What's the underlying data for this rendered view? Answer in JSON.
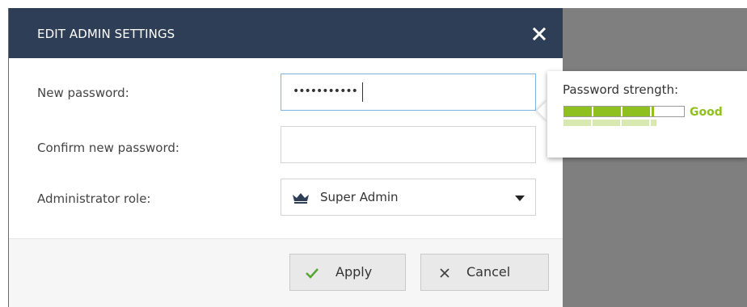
{
  "dialog": {
    "title": "EDIT ADMIN SETTINGS",
    "close_icon": "close-icon",
    "fields": {
      "new_password": {
        "label": "New password:",
        "masked_value": "•••••••••••"
      },
      "confirm_password": {
        "label": "Confirm new password:",
        "value": ""
      },
      "role": {
        "label": "Administrator role:",
        "selected": "Super Admin",
        "icon": "crown-icon"
      }
    },
    "buttons": {
      "apply": "Apply",
      "cancel": "Cancel"
    }
  },
  "password_strength": {
    "label": "Password strength:",
    "value": "Good",
    "level": 0.75
  },
  "colors": {
    "header_bg": "#2f3e57",
    "strength_green": "#8ec01f",
    "apply_check": "#55a630"
  }
}
